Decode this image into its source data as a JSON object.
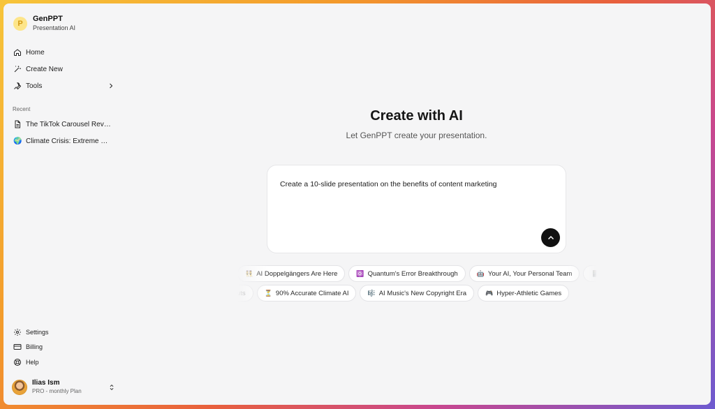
{
  "brand": {
    "name": "GenPPT",
    "subtitle": "Presentation AI",
    "logo_icon": "genppt-logo-icon"
  },
  "nav": {
    "items": [
      {
        "label": "Home",
        "icon": "home-icon"
      },
      {
        "label": "Create New",
        "icon": "magic-wand-icon"
      },
      {
        "label": "Tools",
        "icon": "wrench-icon"
      }
    ]
  },
  "recent": {
    "label": "Recent",
    "items": [
      {
        "label": "The TikTok Carousel Revolu...",
        "icon": "document-icon"
      },
      {
        "label": "Climate Crisis: Extreme We...",
        "emoji": "🌍"
      }
    ]
  },
  "bottom_nav": {
    "items": [
      {
        "label": "Settings",
        "icon": "gear-icon"
      },
      {
        "label": "Billing",
        "icon": "credit-card-icon"
      },
      {
        "label": "Help",
        "icon": "lifebuoy-icon"
      }
    ]
  },
  "user": {
    "name": "Ilias Ism",
    "plan": "PRO - monthly Plan"
  },
  "main": {
    "title": "Create with AI",
    "subtitle": "Let GenPPT create your presentation.",
    "prompt": "Create a 10-slide presentation on the benefits of content marketing"
  },
  "chips": {
    "row1": [
      {
        "emoji": "👯",
        "label": "AI Doppelgängers Are Here"
      },
      {
        "emoji": "⚛️",
        "label": "Quantum's Error Breakthrough"
      },
      {
        "emoji": "🤖",
        "label": "Your AI, Your Personal Team"
      },
      {
        "emoji": "📱",
        "label": ""
      }
    ],
    "row2": [
      {
        "emoji": "",
        "label": "mes Debuts"
      },
      {
        "emoji": "⏳",
        "label": "90% Accurate Climate AI"
      },
      {
        "emoji": "🎼",
        "label": "AI Music's New Copyright Era"
      },
      {
        "emoji": "🎮",
        "label": "Hyper-Athletic Games"
      }
    ]
  },
  "colors": {
    "accent": "#111111",
    "background": "#f5f5f6",
    "logo": "#fde58a"
  }
}
